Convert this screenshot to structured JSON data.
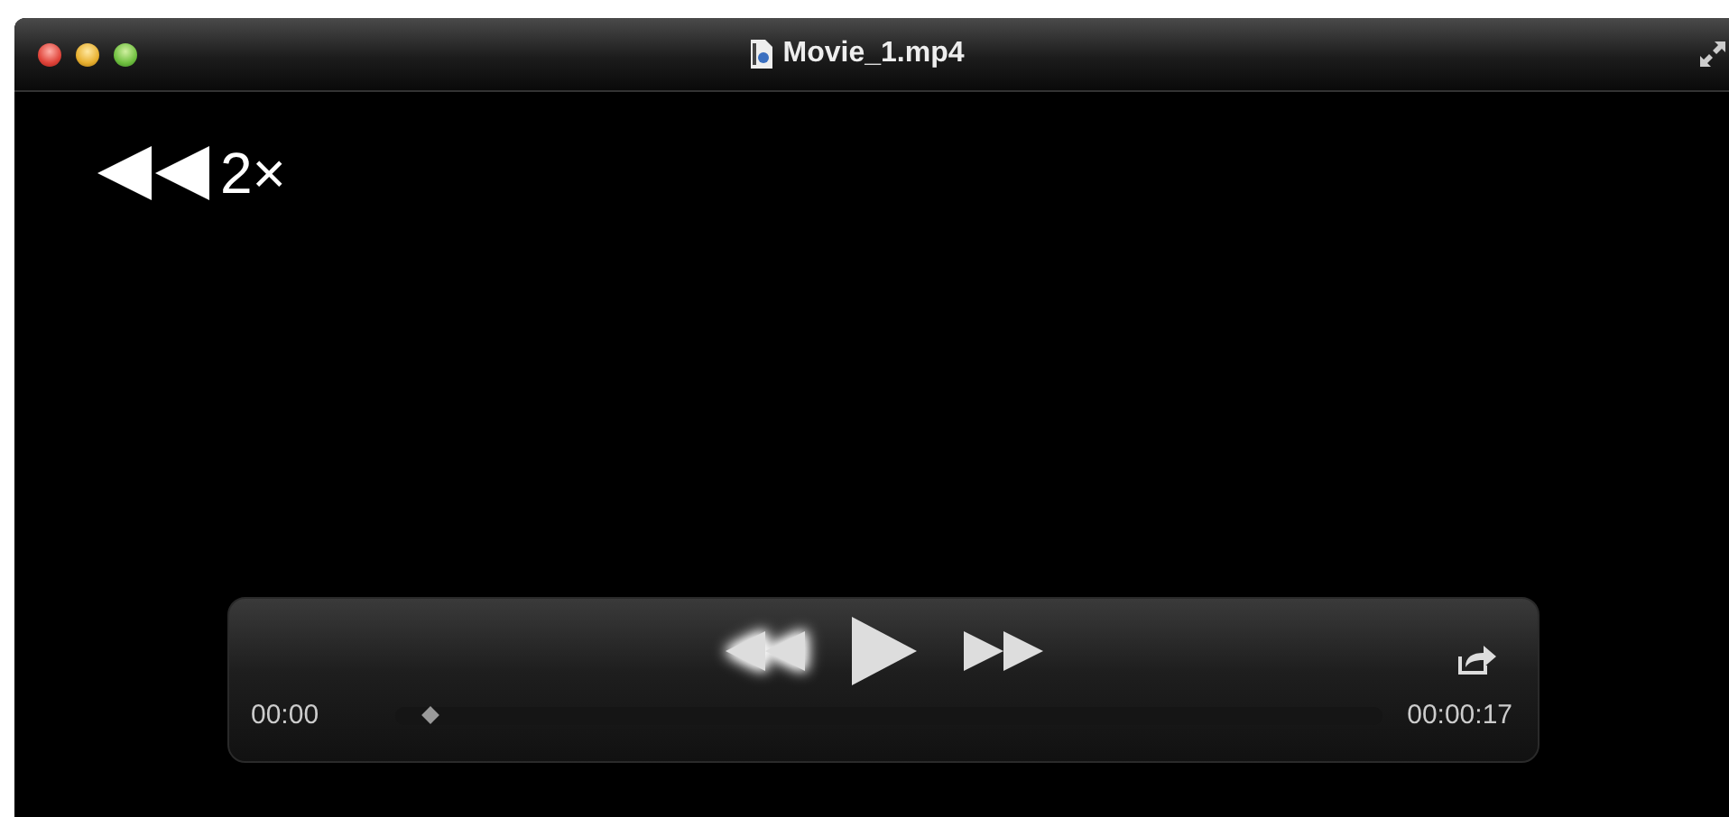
{
  "window": {
    "title": "Movie_1.mp4"
  },
  "speed_indicator": {
    "label": "2×"
  },
  "controls": [
    {
      "kind": "rewind",
      "active": true
    },
    {
      "kind": "play",
      "active": false
    },
    {
      "kind": "forward",
      "active": false
    }
  ],
  "timeline": {
    "elapsed": "00:00",
    "level": 0.03,
    "duration": "00:00:17"
  }
}
